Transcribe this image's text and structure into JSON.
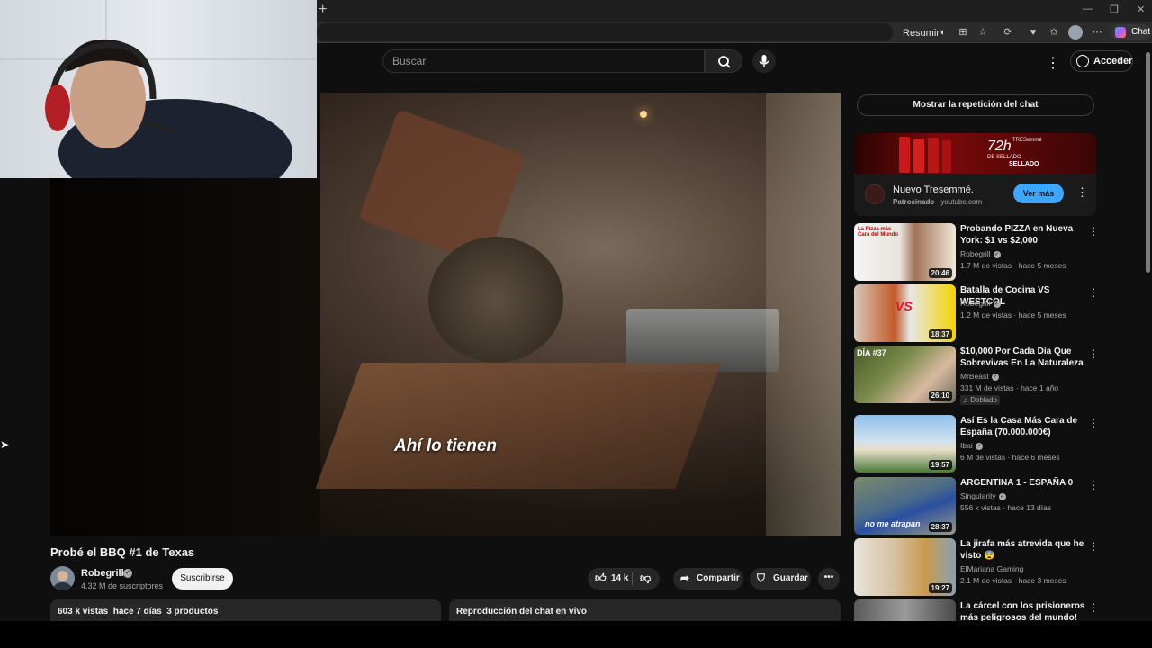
{
  "browser": {
    "new_tab": "+",
    "minimize": "—",
    "restore": "❐",
    "close": "✕",
    "summarize": "Resumir",
    "chat": "Chat"
  },
  "header": {
    "search_placeholder": "Buscar",
    "signin": "Acceder",
    "more": "⋮"
  },
  "player": {
    "subtitle": "Ahí lo tienen"
  },
  "video": {
    "title": "Probé el BBQ #1 de Texas",
    "channel": "Robegrill",
    "subscribers": "4.32 M de suscriptores",
    "subscribe": "Suscribirse",
    "likes": "14 k",
    "share": "Compartir",
    "save": "Guardar",
    "more": "•••",
    "description": "603 k vistas  hace 7 días  3 productos",
    "chat_replay": "Reproducción del chat en vivo"
  },
  "sidebar": {
    "show_chat": "Mostrar la repetición del chat",
    "ad": {
      "title": "Nuevo Tresemmé.",
      "sponsored": "Patrocinado",
      "domain": " · youtube.com",
      "cta": "Ver más",
      "banner_big": "72h",
      "banner_small": "DE SELLADO",
      "banner_tag": "SELLADO",
      "brand": "TRESemmé"
    },
    "recommendations": [
      {
        "title": "Probando PIZZA en Nueva York: $1 vs $2,000",
        "channel": "Robegrill",
        "meta": "1.7 M de vistas · hace 5 meses",
        "duration": "20:46"
      },
      {
        "title": "Batalla de Cocina VS WESTCOL",
        "channel": "Robegrill",
        "meta": "1.2 M de vistas · hace 5 meses",
        "duration": "18:37"
      },
      {
        "title": "$10,000 Por Cada Día Que Sobrevivas En La Naturaleza",
        "channel": "MrBeast",
        "meta": "331 M de vistas · hace 1 año",
        "duration": "26:10",
        "badge": "Doblado"
      },
      {
        "title": "Así Es la Casa Más Cara de España (70.000.000€)",
        "channel": "Ibai",
        "meta": "6 M de vistas · hace 6 meses",
        "duration": "19:57"
      },
      {
        "title": "ARGENTINA 1 - ESPAÑA 0",
        "channel": "Singularity",
        "meta": "556 k vistas · hace 13 días",
        "duration": "28:37"
      },
      {
        "title": "La jirafa más atrevida que he visto 😨",
        "channel": "ElMariana Gaming",
        "meta": "2.1 M de vistas · hace 3 meses",
        "duration": "19:27"
      },
      {
        "title": "La cárcel con los prisioneros más peligrosos del mundo!",
        "channel": "",
        "meta": "",
        "duration": ""
      }
    ],
    "thumb_texts": {
      "t1": "La Pizza más Cara del Mundo",
      "t2": "VS",
      "t3": "DÍA #37",
      "t5": "no me atrapan"
    }
  }
}
